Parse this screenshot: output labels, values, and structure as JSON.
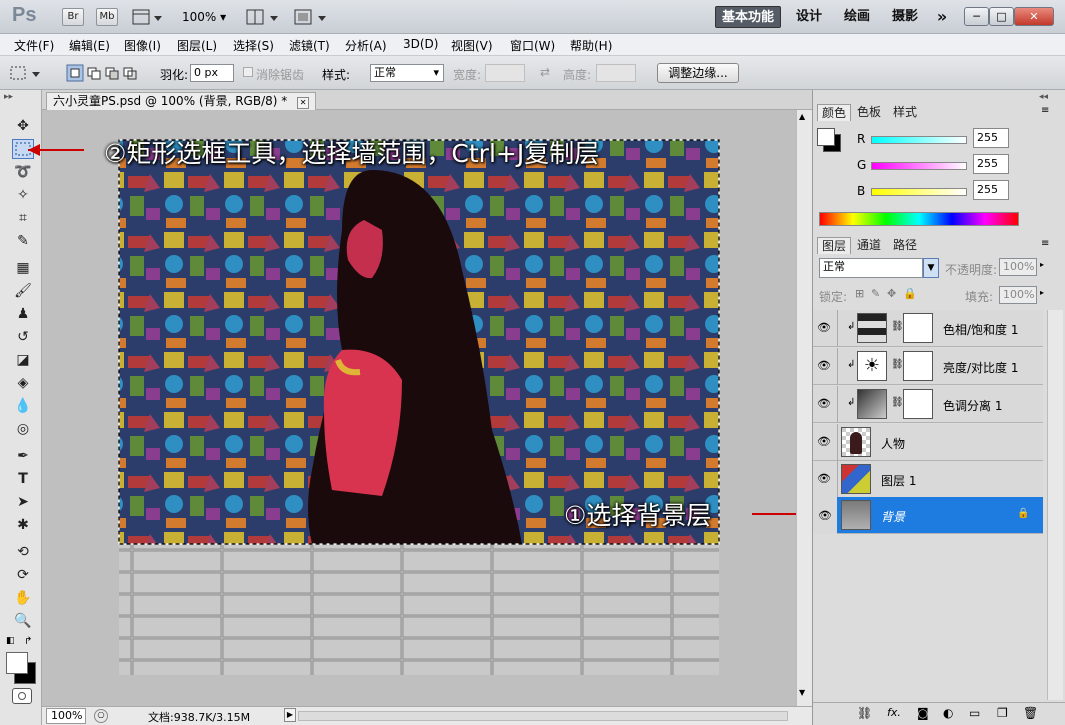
{
  "app": {
    "logo": "Ps",
    "br": "Br",
    "mb": "Mb",
    "zoom": "100%",
    "workspaces": [
      "基本功能",
      "设计",
      "绘画",
      "摄影"
    ],
    "more": "»",
    "win_min": "─",
    "win_max": "□",
    "win_close": "✕"
  },
  "menu": [
    "文件(F)",
    "编辑(E)",
    "图像(I)",
    "图层(L)",
    "选择(S)",
    "滤镜(T)",
    "分析(A)",
    "3D(D)",
    "视图(V)",
    "窗口(W)",
    "帮助(H)"
  ],
  "options": {
    "feather_label": "羽化:",
    "feather_value": "0 px",
    "antialias_label": "消除锯齿",
    "style_label": "样式:",
    "style_value": "正常",
    "width_label": "宽度:",
    "height_label": "高度:",
    "refine_button": "调整边缘..."
  },
  "document": {
    "tab_title": "六小灵童PS.psd @ 100% (背景, RGB/8) *",
    "tab_close": "✕",
    "zoom_status": "100%",
    "doc_info": "文档:938.7K/3.15M"
  },
  "annotations": {
    "top": "②矩形选框工具，选择墙范围，Ctrl+J复制层",
    "bottom": "①选择背景层"
  },
  "color_panel": {
    "tabs": [
      "颜色",
      "色板",
      "样式"
    ],
    "channels": [
      {
        "label": "R",
        "value": "255"
      },
      {
        "label": "G",
        "value": "255"
      },
      {
        "label": "B",
        "value": "255"
      }
    ]
  },
  "layers_panel": {
    "tabs": [
      "图层",
      "通道",
      "路径"
    ],
    "blend_mode": "正常",
    "opacity_label": "不透明度:",
    "opacity_value": "100%",
    "lock_label": "锁定:",
    "fill_label": "填充:",
    "fill_value": "100%",
    "layers": [
      {
        "name": "色相/饱和度 1"
      },
      {
        "name": "亮度/对比度 1"
      },
      {
        "name": "色调分离 1"
      },
      {
        "name": "人物"
      },
      {
        "name": "图层 1"
      },
      {
        "name": "背景"
      }
    ]
  },
  "colors": {
    "accent": "#1e7be0",
    "selection_bg": "#1e7be0"
  }
}
